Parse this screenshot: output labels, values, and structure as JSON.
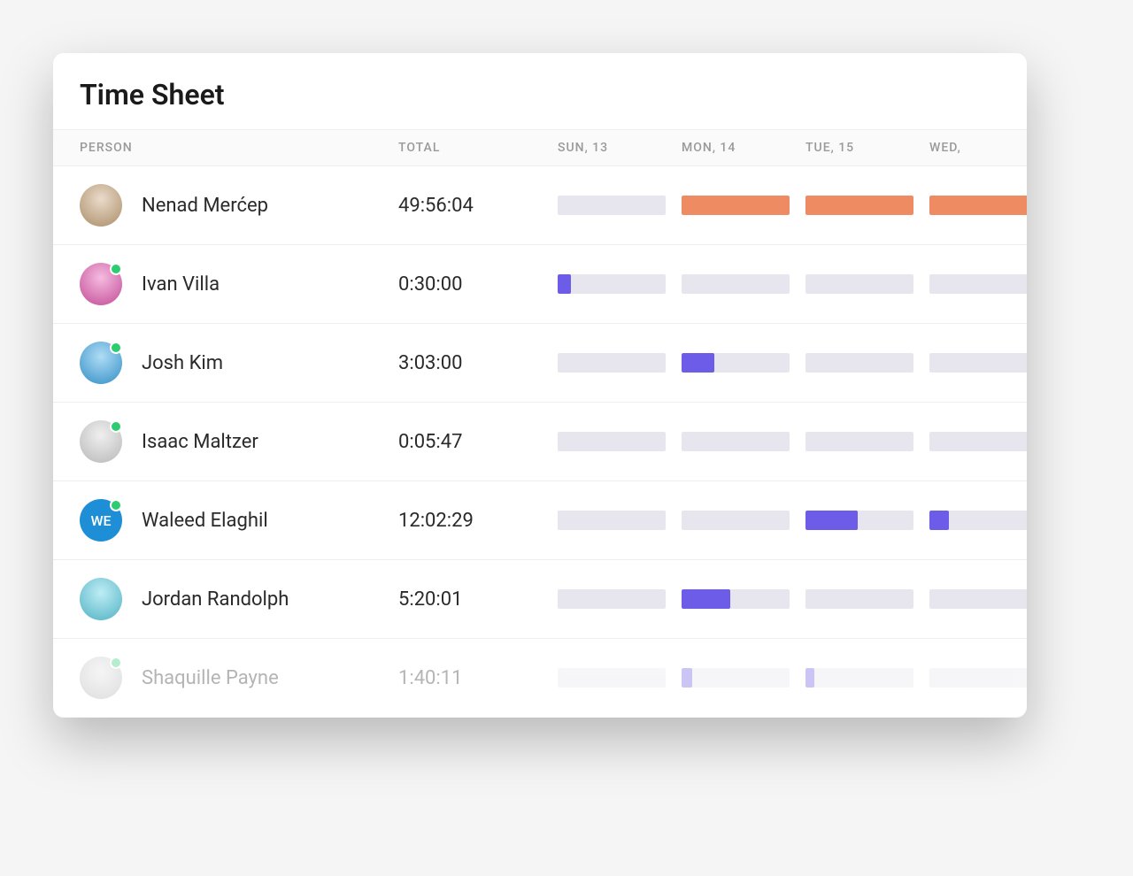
{
  "title": "Time Sheet",
  "columns": {
    "person": "PERSON",
    "total": "TOTAL",
    "days": [
      "SUN, 13",
      "MON, 14",
      "TUE, 15",
      "WED,"
    ]
  },
  "colors": {
    "orange": "#ef8b63",
    "purple": "#6c5ce7",
    "barBg": "#e7e6ee"
  },
  "rows": [
    {
      "name": "Nenad Merćep",
      "total": "49:56:04",
      "avatar": {
        "type": "photo",
        "bg": "#c9a57a"
      },
      "online": false,
      "faded": false,
      "bars": [
        {
          "fill": 0,
          "color": "orange"
        },
        {
          "fill": 100,
          "color": "orange"
        },
        {
          "fill": 100,
          "color": "orange"
        },
        {
          "fill": 100,
          "color": "orange"
        }
      ]
    },
    {
      "name": "Ivan Villa",
      "total": "0:30:00",
      "avatar": {
        "type": "photo",
        "bg": "#e557b1"
      },
      "online": true,
      "faded": false,
      "bars": [
        {
          "fill": 12,
          "color": "purple"
        },
        {
          "fill": 0,
          "color": "purple"
        },
        {
          "fill": 0,
          "color": "purple"
        },
        {
          "fill": 0,
          "color": "purple"
        }
      ]
    },
    {
      "name": "Josh Kim",
      "total": "3:03:00",
      "avatar": {
        "type": "photo",
        "bg": "#3aa8e8"
      },
      "online": true,
      "faded": false,
      "bars": [
        {
          "fill": 0,
          "color": "purple"
        },
        {
          "fill": 30,
          "color": "purple"
        },
        {
          "fill": 0,
          "color": "purple"
        },
        {
          "fill": 0,
          "color": "purple"
        }
      ]
    },
    {
      "name": "Isaac Maltzer",
      "total": "0:05:47",
      "avatar": {
        "type": "photo",
        "bg": "#d8d8d8"
      },
      "online": true,
      "faded": false,
      "bars": [
        {
          "fill": 0,
          "color": "purple"
        },
        {
          "fill": 0,
          "color": "purple"
        },
        {
          "fill": 0,
          "color": "purple"
        },
        {
          "fill": 0,
          "color": "purple"
        }
      ]
    },
    {
      "name": "Waleed Elaghil",
      "total": "12:02:29",
      "avatar": {
        "type": "initials",
        "initials": "WE",
        "bg": "#1e8fd6"
      },
      "online": true,
      "faded": false,
      "bars": [
        {
          "fill": 0,
          "color": "purple"
        },
        {
          "fill": 0,
          "color": "purple"
        },
        {
          "fill": 48,
          "color": "purple"
        },
        {
          "fill": 18,
          "color": "purple"
        }
      ]
    },
    {
      "name": "Jordan Randolph",
      "total": "5:20:01",
      "avatar": {
        "type": "photo",
        "bg": "#5ed1e6"
      },
      "online": false,
      "faded": false,
      "bars": [
        {
          "fill": 0,
          "color": "purple"
        },
        {
          "fill": 45,
          "color": "purple"
        },
        {
          "fill": 0,
          "color": "purple"
        },
        {
          "fill": 0,
          "color": "purple"
        }
      ]
    },
    {
      "name": "Shaquille Payne",
      "total": "1:40:11",
      "avatar": {
        "type": "photo",
        "bg": "#bdbdbd"
      },
      "online": true,
      "faded": true,
      "bars": [
        {
          "fill": 0,
          "color": "purple"
        },
        {
          "fill": 10,
          "color": "purple"
        },
        {
          "fill": 8,
          "color": "purple"
        },
        {
          "fill": 0,
          "color": "purple"
        }
      ]
    }
  ]
}
